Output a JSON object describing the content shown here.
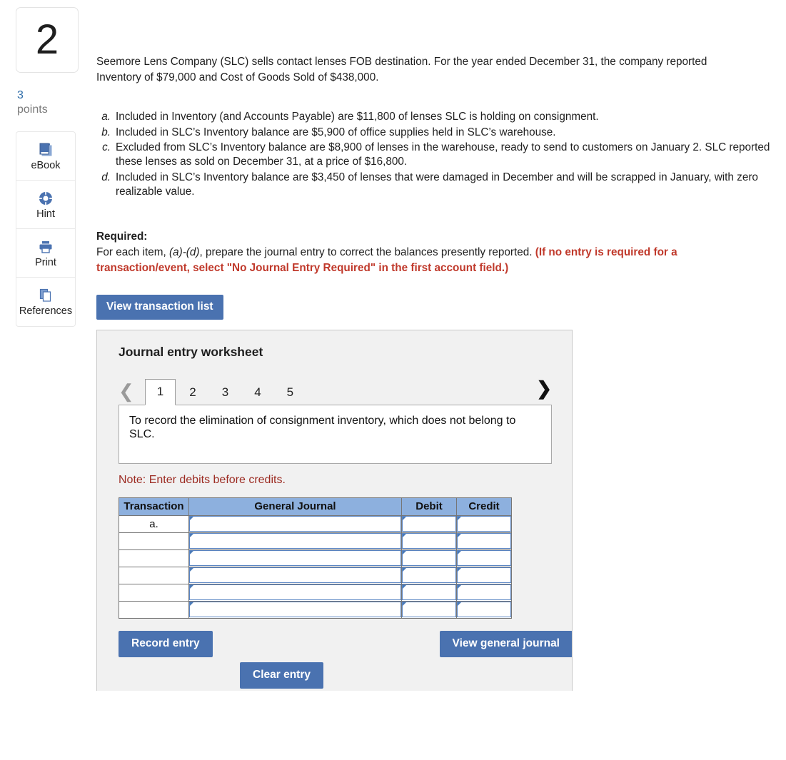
{
  "question": {
    "number": "2",
    "points_value": "3",
    "points_label": "points"
  },
  "tools": [
    {
      "label": "eBook",
      "icon": "book-icon"
    },
    {
      "label": "Hint",
      "icon": "life-ring-icon"
    },
    {
      "label": "Print",
      "icon": "printer-icon"
    },
    {
      "label": "References",
      "icon": "copy-stack-icon"
    }
  ],
  "intro": "Seemore Lens Company (SLC) sells contact lenses FOB destination. For the year ended December 31, the company reported Inventory of $79,000 and Cost of Goods Sold of $438,000.",
  "items": [
    {
      "letter": "a.",
      "text": "Included in Inventory (and Accounts Payable) are $11,800 of lenses SLC is holding on consignment."
    },
    {
      "letter": "b.",
      "text": "Included in SLC’s Inventory balance are $5,900 of office supplies held in SLC’s warehouse."
    },
    {
      "letter": "c.",
      "text": "Excluded from SLC’s Inventory balance are $8,900 of lenses in the warehouse, ready to send to customers on January 2. SLC reported these lenses as sold on December 31, at a price of $16,800."
    },
    {
      "letter": "d.",
      "text": "Included in SLC’s Inventory balance are $3,450 of lenses that were damaged in December and will be scrapped in January, with zero realizable value."
    }
  ],
  "required": {
    "heading": "Required:",
    "line_part1": "For each item, ",
    "line_italic": "(a)-(d)",
    "line_part2": ", prepare the journal entry to correct the balances presently reported. ",
    "line_red": "(If no entry is required for a transaction/event, select \"No Journal Entry Required\" in the first account field.)"
  },
  "view_transaction_list_label": "View transaction list",
  "worksheet": {
    "title": "Journal entry worksheet",
    "prev_icon": "chevron-left-icon",
    "next_icon": "chevron-right-icon",
    "tabs": [
      "1",
      "2",
      "3",
      "4",
      "5"
    ],
    "active_tab": "1",
    "description": "To record the elimination of consignment inventory, which does not belong to SLC.",
    "note": "Note: Enter debits before credits.",
    "table": {
      "headers": [
        "Transaction",
        "General Journal",
        "Debit",
        "Credit"
      ],
      "rows": [
        {
          "transaction": "a.",
          "general_journal": "",
          "debit": "",
          "credit": ""
        },
        {
          "transaction": "",
          "general_journal": "",
          "debit": "",
          "credit": ""
        },
        {
          "transaction": "",
          "general_journal": "",
          "debit": "",
          "credit": ""
        },
        {
          "transaction": "",
          "general_journal": "",
          "debit": "",
          "credit": ""
        },
        {
          "transaction": "",
          "general_journal": "",
          "debit": "",
          "credit": ""
        },
        {
          "transaction": "",
          "general_journal": "",
          "debit": "",
          "credit": ""
        }
      ]
    },
    "buttons": {
      "record": "Record entry",
      "clear": "Clear entry",
      "view_general_journal": "View general journal"
    }
  },
  "colors": {
    "button_blue": "#4a72b0",
    "table_header_blue": "#8db0de",
    "note_red": "#9c2b22",
    "required_red": "#c0392b",
    "points_blue": "#2d6ca8",
    "panel_gray": "#f1f1f1"
  }
}
